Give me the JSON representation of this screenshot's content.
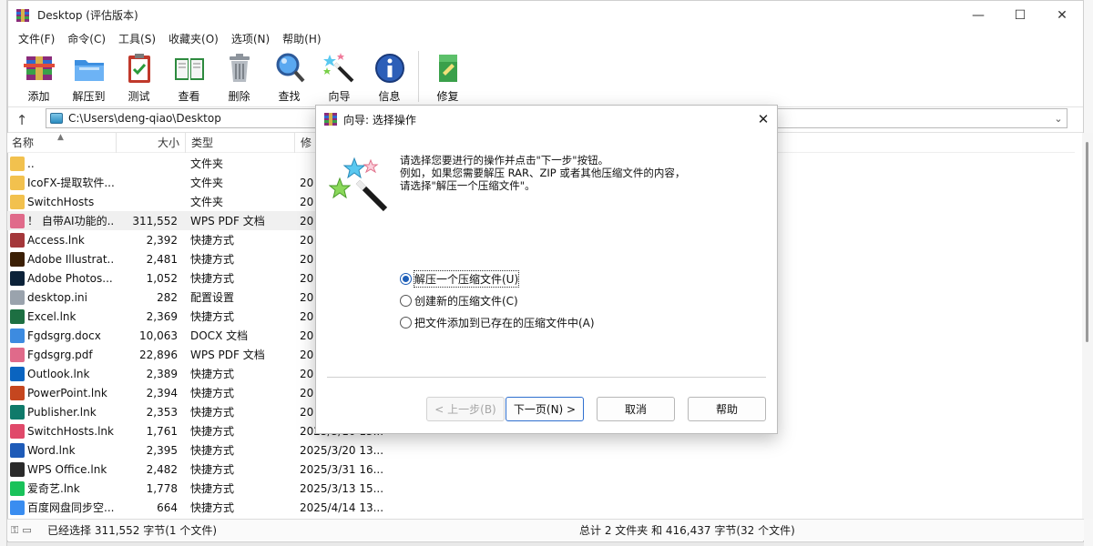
{
  "window": {
    "title": "Desktop (评估版本)"
  },
  "menu": [
    "文件(F)",
    "命令(C)",
    "工具(S)",
    "收藏夹(O)",
    "选项(N)",
    "帮助(H)"
  ],
  "toolbar": [
    {
      "label": "添加",
      "icon": "add-archive-icon"
    },
    {
      "label": "解压到",
      "icon": "extract-folder-icon"
    },
    {
      "label": "测试",
      "icon": "test-clipboard-icon"
    },
    {
      "label": "查看",
      "icon": "view-book-icon"
    },
    {
      "label": "删除",
      "icon": "trash-icon"
    },
    {
      "label": "查找",
      "icon": "magnifier-icon"
    },
    {
      "label": "向导",
      "icon": "wizard-wand-icon"
    },
    {
      "label": "信息",
      "icon": "info-icon"
    },
    {
      "label": "修复",
      "icon": "repair-icon"
    }
  ],
  "address": {
    "path": "C:\\Users\\deng-qiao\\Desktop"
  },
  "columns": {
    "name": "名称",
    "size": "大小",
    "type": "类型",
    "modified": "修"
  },
  "files": [
    {
      "name": "..",
      "size": "",
      "type": "文件夹",
      "mod": "",
      "icon": "folder-icon",
      "color": "#f2c14e"
    },
    {
      "name": "IcoFX-提取软件...",
      "size": "",
      "type": "文件夹",
      "mod": "20",
      "icon": "folder-icon",
      "color": "#f2c14e"
    },
    {
      "name": "SwitchHosts",
      "size": "",
      "type": "文件夹",
      "mod": "20",
      "icon": "folder-icon",
      "color": "#f2c14e"
    },
    {
      "name": "！ 自带AI功能的...",
      "size": "311,552",
      "type": "WPS PDF 文档",
      "mod": "20",
      "icon": "wps-pdf-icon",
      "color": "#e06a8a",
      "selected": true
    },
    {
      "name": "Access.lnk",
      "size": "2,392",
      "type": "快捷方式",
      "mod": "20",
      "icon": "access-icon",
      "color": "#a4373a"
    },
    {
      "name": "Adobe Illustrat...",
      "size": "2,481",
      "type": "快捷方式",
      "mod": "20",
      "icon": "illustrator-icon",
      "color": "#3b1f05"
    },
    {
      "name": "Adobe Photos...",
      "size": "1,052",
      "type": "快捷方式",
      "mod": "20",
      "icon": "photoshop-icon",
      "color": "#0b2239"
    },
    {
      "name": "desktop.ini",
      "size": "282",
      "type": "配置设置",
      "mod": "20",
      "icon": "ini-file-icon",
      "color": "#9aa3ad"
    },
    {
      "name": "Excel.lnk",
      "size": "2,369",
      "type": "快捷方式",
      "mod": "20",
      "icon": "excel-icon",
      "color": "#1d6f42"
    },
    {
      "name": "Fgdsgrg.docx",
      "size": "10,063",
      "type": "DOCX 文档",
      "mod": "20",
      "icon": "docx-icon",
      "color": "#3d8be0"
    },
    {
      "name": "Fgdsgrg.pdf",
      "size": "22,896",
      "type": "WPS PDF 文档",
      "mod": "20",
      "icon": "wps-pdf-icon",
      "color": "#e06a8a"
    },
    {
      "name": "Outlook.lnk",
      "size": "2,389",
      "type": "快捷方式",
      "mod": "20",
      "icon": "outlook-icon",
      "color": "#0a64c0"
    },
    {
      "name": "PowerPoint.lnk",
      "size": "2,394",
      "type": "快捷方式",
      "mod": "20",
      "icon": "powerpoint-icon",
      "color": "#c5461f"
    },
    {
      "name": "Publisher.lnk",
      "size": "2,353",
      "type": "快捷方式",
      "mod": "20",
      "icon": "publisher-icon",
      "color": "#0f7a6a"
    },
    {
      "name": "SwitchHosts.lnk",
      "size": "1,761",
      "type": "快捷方式",
      "mod": "2025/3/10 13...",
      "icon": "switchhosts-icon",
      "color": "#e0496a"
    },
    {
      "name": "Word.lnk",
      "size": "2,395",
      "type": "快捷方式",
      "mod": "2025/3/20 13...",
      "icon": "word-icon",
      "color": "#1e5bb8"
    },
    {
      "name": "WPS Office.lnk",
      "size": "2,482",
      "type": "快捷方式",
      "mod": "2025/3/31 16...",
      "icon": "wps-office-icon",
      "color": "#2a2a2a"
    },
    {
      "name": "爱奇艺.lnk",
      "size": "1,778",
      "type": "快捷方式",
      "mod": "2025/3/13 15...",
      "icon": "iqiyi-icon",
      "color": "#19c25a"
    },
    {
      "name": "百度网盘同步空...",
      "size": "664",
      "type": "快捷方式",
      "mod": "2025/4/14 13...",
      "icon": "baidu-netdisk-icon",
      "color": "#3a8df0"
    }
  ],
  "status": {
    "left": "已经选择 311,552 字节(1 个文件)",
    "right": "总计 2 文件夹 和 416,437 字节(32 个文件)"
  },
  "dialog": {
    "title": "向导: 选择操作",
    "instructions": [
      "请选择您要进行的操作并点击\"下一步\"按钮。",
      "例如，如果您需要解压 RAR、ZIP 或者其他压缩文件的内容，",
      "请选择\"解压一个压缩文件\"。"
    ],
    "options": [
      {
        "label": "解压一个压缩文件(U)",
        "checked": true
      },
      {
        "label": "创建新的压缩文件(C)",
        "checked": false
      },
      {
        "label": "把文件添加到已存在的压缩文件中(A)",
        "checked": false
      }
    ],
    "buttons": {
      "back": "< 上一步(B)",
      "next": "下一页(N) >",
      "cancel": "取消",
      "help": "帮助"
    }
  }
}
